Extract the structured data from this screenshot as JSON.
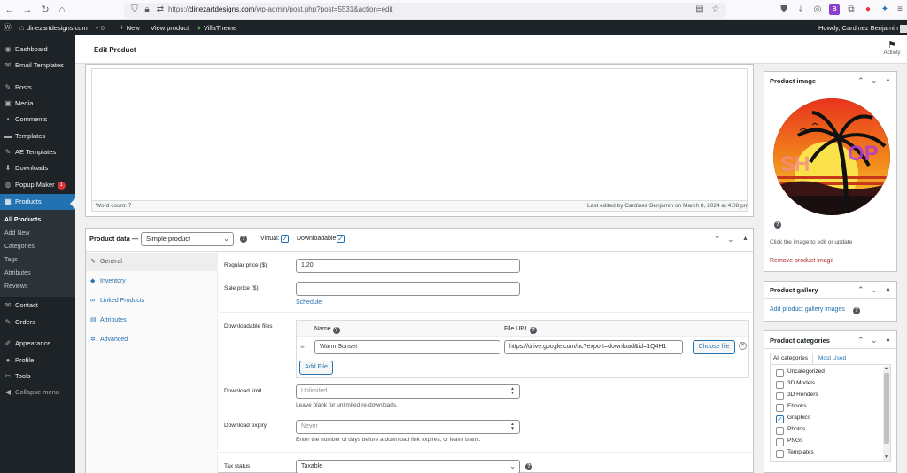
{
  "browser": {
    "url_prefix": "https://",
    "url_host": "dinezartdesigns.com",
    "url_path": "/wp-admin/post.php?post=5531&action=edit"
  },
  "admin_bar": {
    "site_name": "dinezartdesigns.com",
    "comments_count": "0",
    "new_label": "New",
    "view_product": "View product",
    "villatheme": "VillaTheme",
    "howdy": "Howdy, Cardinez Benjamin"
  },
  "sidebar": {
    "items": [
      {
        "label": "Dashboard",
        "icon": "dashboard-icon"
      },
      {
        "label": "Email Templates",
        "icon": "email-icon"
      },
      {
        "label": "Posts",
        "icon": "pin-icon"
      },
      {
        "label": "Media",
        "icon": "media-icon"
      },
      {
        "label": "Comments",
        "icon": "comment-icon"
      },
      {
        "label": "Templates",
        "icon": "folder-icon"
      },
      {
        "label": "AE Templates",
        "icon": "pin-icon"
      },
      {
        "label": "Downloads",
        "icon": "download-icon"
      },
      {
        "label": "Popup Maker",
        "icon": "popup-icon",
        "badge": "1"
      },
      {
        "label": "Products",
        "icon": "products-icon"
      },
      {
        "label": "Contact",
        "icon": "mail-icon"
      },
      {
        "label": "Orders",
        "icon": "pin-icon"
      },
      {
        "label": "Appearance",
        "icon": "brush-icon"
      },
      {
        "label": "Profile",
        "icon": "user-icon"
      },
      {
        "label": "Tools",
        "icon": "wrench-icon"
      },
      {
        "label": "Collapse menu",
        "icon": "collapse-icon"
      }
    ],
    "submenu": [
      "All Products",
      "Add New",
      "Categories",
      "Tags",
      "Attributes",
      "Reviews"
    ]
  },
  "header": {
    "title": "Edit Product",
    "activity": "Activity"
  },
  "editor": {
    "word_count": "Word count: 7",
    "last_edited": "Last edited by Cardinez Benjamin on March 8, 2024 at 4:08 pm"
  },
  "product_data": {
    "label": "Product data —",
    "type": "Simple product",
    "virtual_label": "Virtual:",
    "virtual_checked": true,
    "downloadable_label": "Downloadable:",
    "downloadable_checked": true,
    "tabs": [
      {
        "label": "General",
        "icon": "wrench-icon"
      },
      {
        "label": "Inventory",
        "icon": "tag-icon"
      },
      {
        "label": "Linked Products",
        "icon": "link-icon"
      },
      {
        "label": "Attributes",
        "icon": "list-icon"
      },
      {
        "label": "Advanced",
        "icon": "gear-icon"
      }
    ],
    "regular_price_label": "Regular price ($)",
    "regular_price": "1.20",
    "sale_price_label": "Sale price ($)",
    "sale_price": "",
    "schedule": "Schedule",
    "downloadable_files_label": "Downloadable files",
    "col_name": "Name",
    "col_url": "File URL",
    "file_name": "Warm Sunset",
    "file_url": "https://drive.google.com/uc?export=download&id=1Q4H1",
    "choose_file": "Choose file",
    "add_file": "Add File",
    "download_limit_label": "Download limit",
    "download_limit_placeholder": "Unlimited",
    "download_limit_desc": "Leave blank for unlimited re-downloads.",
    "download_expiry_label": "Download expiry",
    "download_expiry_placeholder": "Never",
    "download_expiry_desc": "Enter the number of days before a download link expires, or leave blank.",
    "tax_status_label": "Tax status",
    "tax_status": "Taxable"
  },
  "product_image": {
    "title": "Product image",
    "hint": "Click the image to edit or update",
    "remove": "Remove product image"
  },
  "product_gallery": {
    "title": "Product gallery",
    "add": "Add product gallery images"
  },
  "product_categories": {
    "title": "Product categories",
    "tab_all": "All categories",
    "tab_most": "Most Used",
    "items": [
      {
        "label": "Uncategorized",
        "checked": false
      },
      {
        "label": "3D Models",
        "checked": false
      },
      {
        "label": "3D Renders",
        "checked": false
      },
      {
        "label": "Ebooks",
        "checked": false
      },
      {
        "label": "Graphics",
        "checked": true
      },
      {
        "label": "Photos",
        "checked": false
      },
      {
        "label": "PNGs",
        "checked": false
      },
      {
        "label": "Templates",
        "checked": false
      }
    ]
  },
  "colors": {
    "admin_dark": "#1d2327",
    "accent": "#2271b1",
    "danger": "#d63638"
  }
}
